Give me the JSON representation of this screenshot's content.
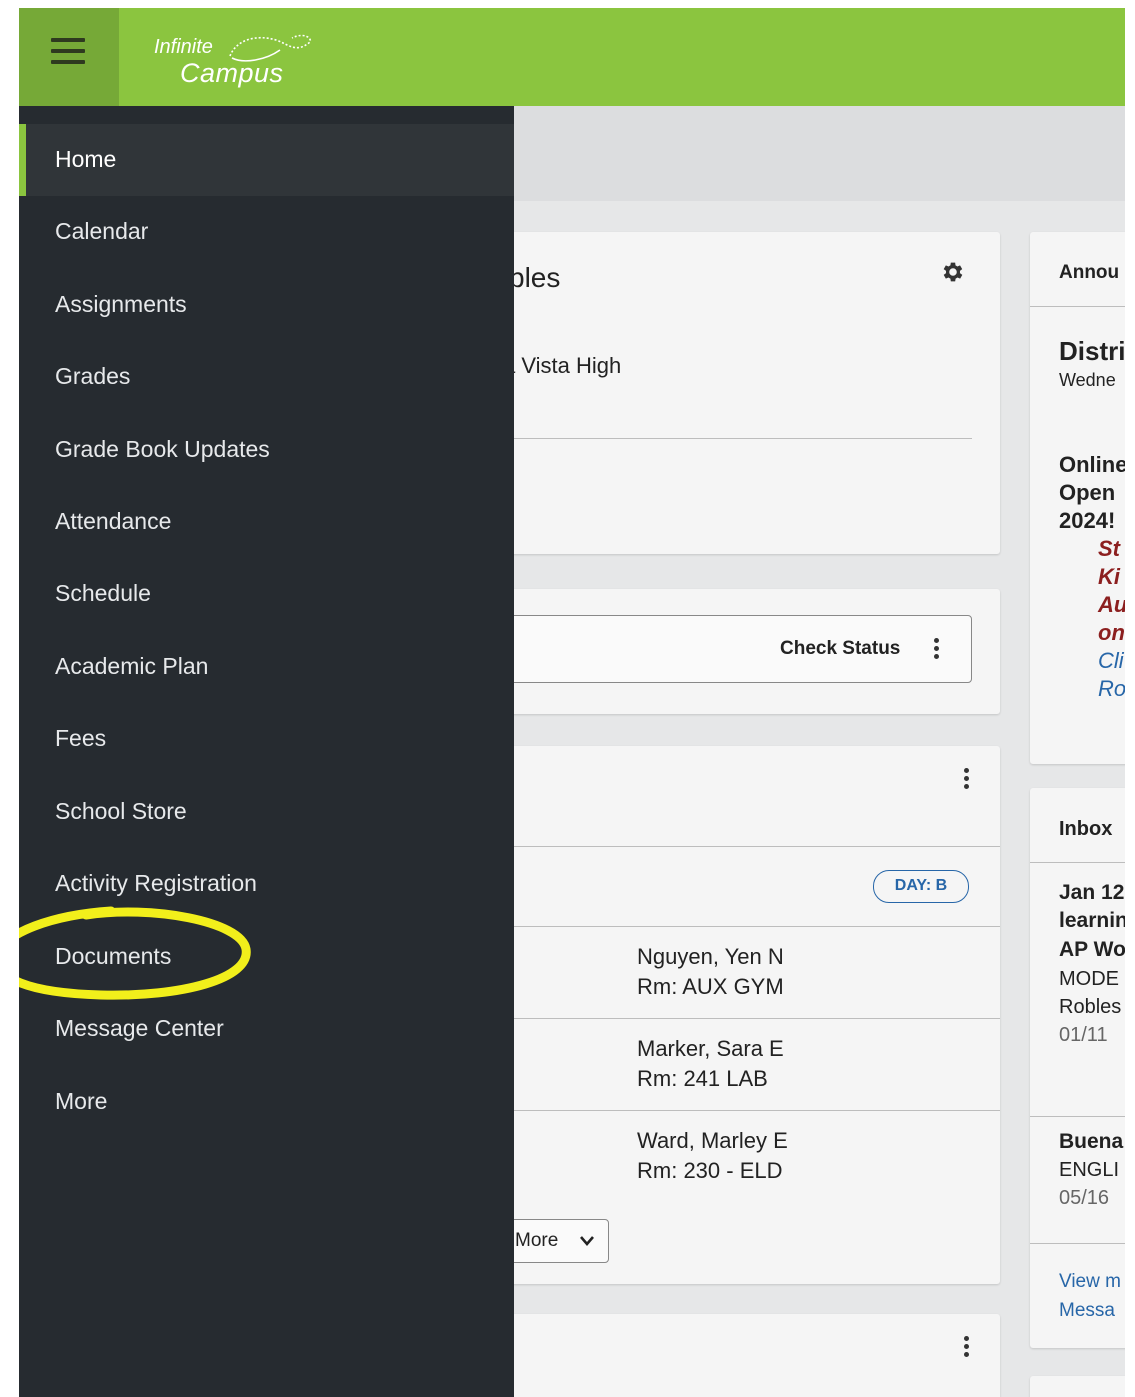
{
  "app": {
    "logo_top": "Infinite",
    "logo_bottom": "Campus"
  },
  "nav": {
    "items": [
      {
        "label": "Home",
        "active": true
      },
      {
        "label": "Calendar"
      },
      {
        "label": "Assignments"
      },
      {
        "label": "Grades"
      },
      {
        "label": "Grade Book Updates"
      },
      {
        "label": "Attendance"
      },
      {
        "label": "Schedule"
      },
      {
        "label": "Academic Plan"
      },
      {
        "label": "Fees"
      },
      {
        "label": "School Store"
      },
      {
        "label": "Activity Registration"
      },
      {
        "label": "Documents"
      },
      {
        "label": "Message Center"
      },
      {
        "label": "More"
      }
    ]
  },
  "student_card": {
    "name_fragment": "bles",
    "school_fragment": "a Vista High"
  },
  "status_card": {
    "check_status_label": "Check Status"
  },
  "schedule_card": {
    "day_badge": "DAY: B",
    "rows": [
      {
        "teacher": "Nguyen, Yen N",
        "room": "Rm: AUX GYM"
      },
      {
        "teacher": "Marker, Sara E",
        "room": "Rm: 241 LAB"
      },
      {
        "teacher": "Ward, Marley E",
        "room": "Rm: 230 - ELD"
      }
    ],
    "more_label": "More"
  },
  "announcements": {
    "header": "Annou",
    "title": "Distri",
    "date": "Wedne",
    "bold_lines": [
      "Online",
      "Open",
      "2024!"
    ],
    "red_lines": [
      "St",
      "Ki",
      "Au",
      "on"
    ],
    "blue_lines": [
      "Cli",
      "Ro"
    ]
  },
  "inbox": {
    "header": "Inbox",
    "message1": {
      "line1": "Jan 12",
      "line2": "learnin",
      "line3": "AP Wo",
      "line4": "MODE",
      "line5": "Robles",
      "date": "01/11"
    },
    "message2": {
      "line1": "Buena",
      "line2": "ENGLI",
      "date": "05/16"
    },
    "view_line1": "View m",
    "view_line2": "Messa"
  },
  "colors": {
    "brand_green": "#8bc53f",
    "drawer_bg": "#262b30",
    "link_blue": "#2766a8",
    "annotation_red": "#8c1f1f",
    "highlight_yellow": "#f2ef1b"
  }
}
